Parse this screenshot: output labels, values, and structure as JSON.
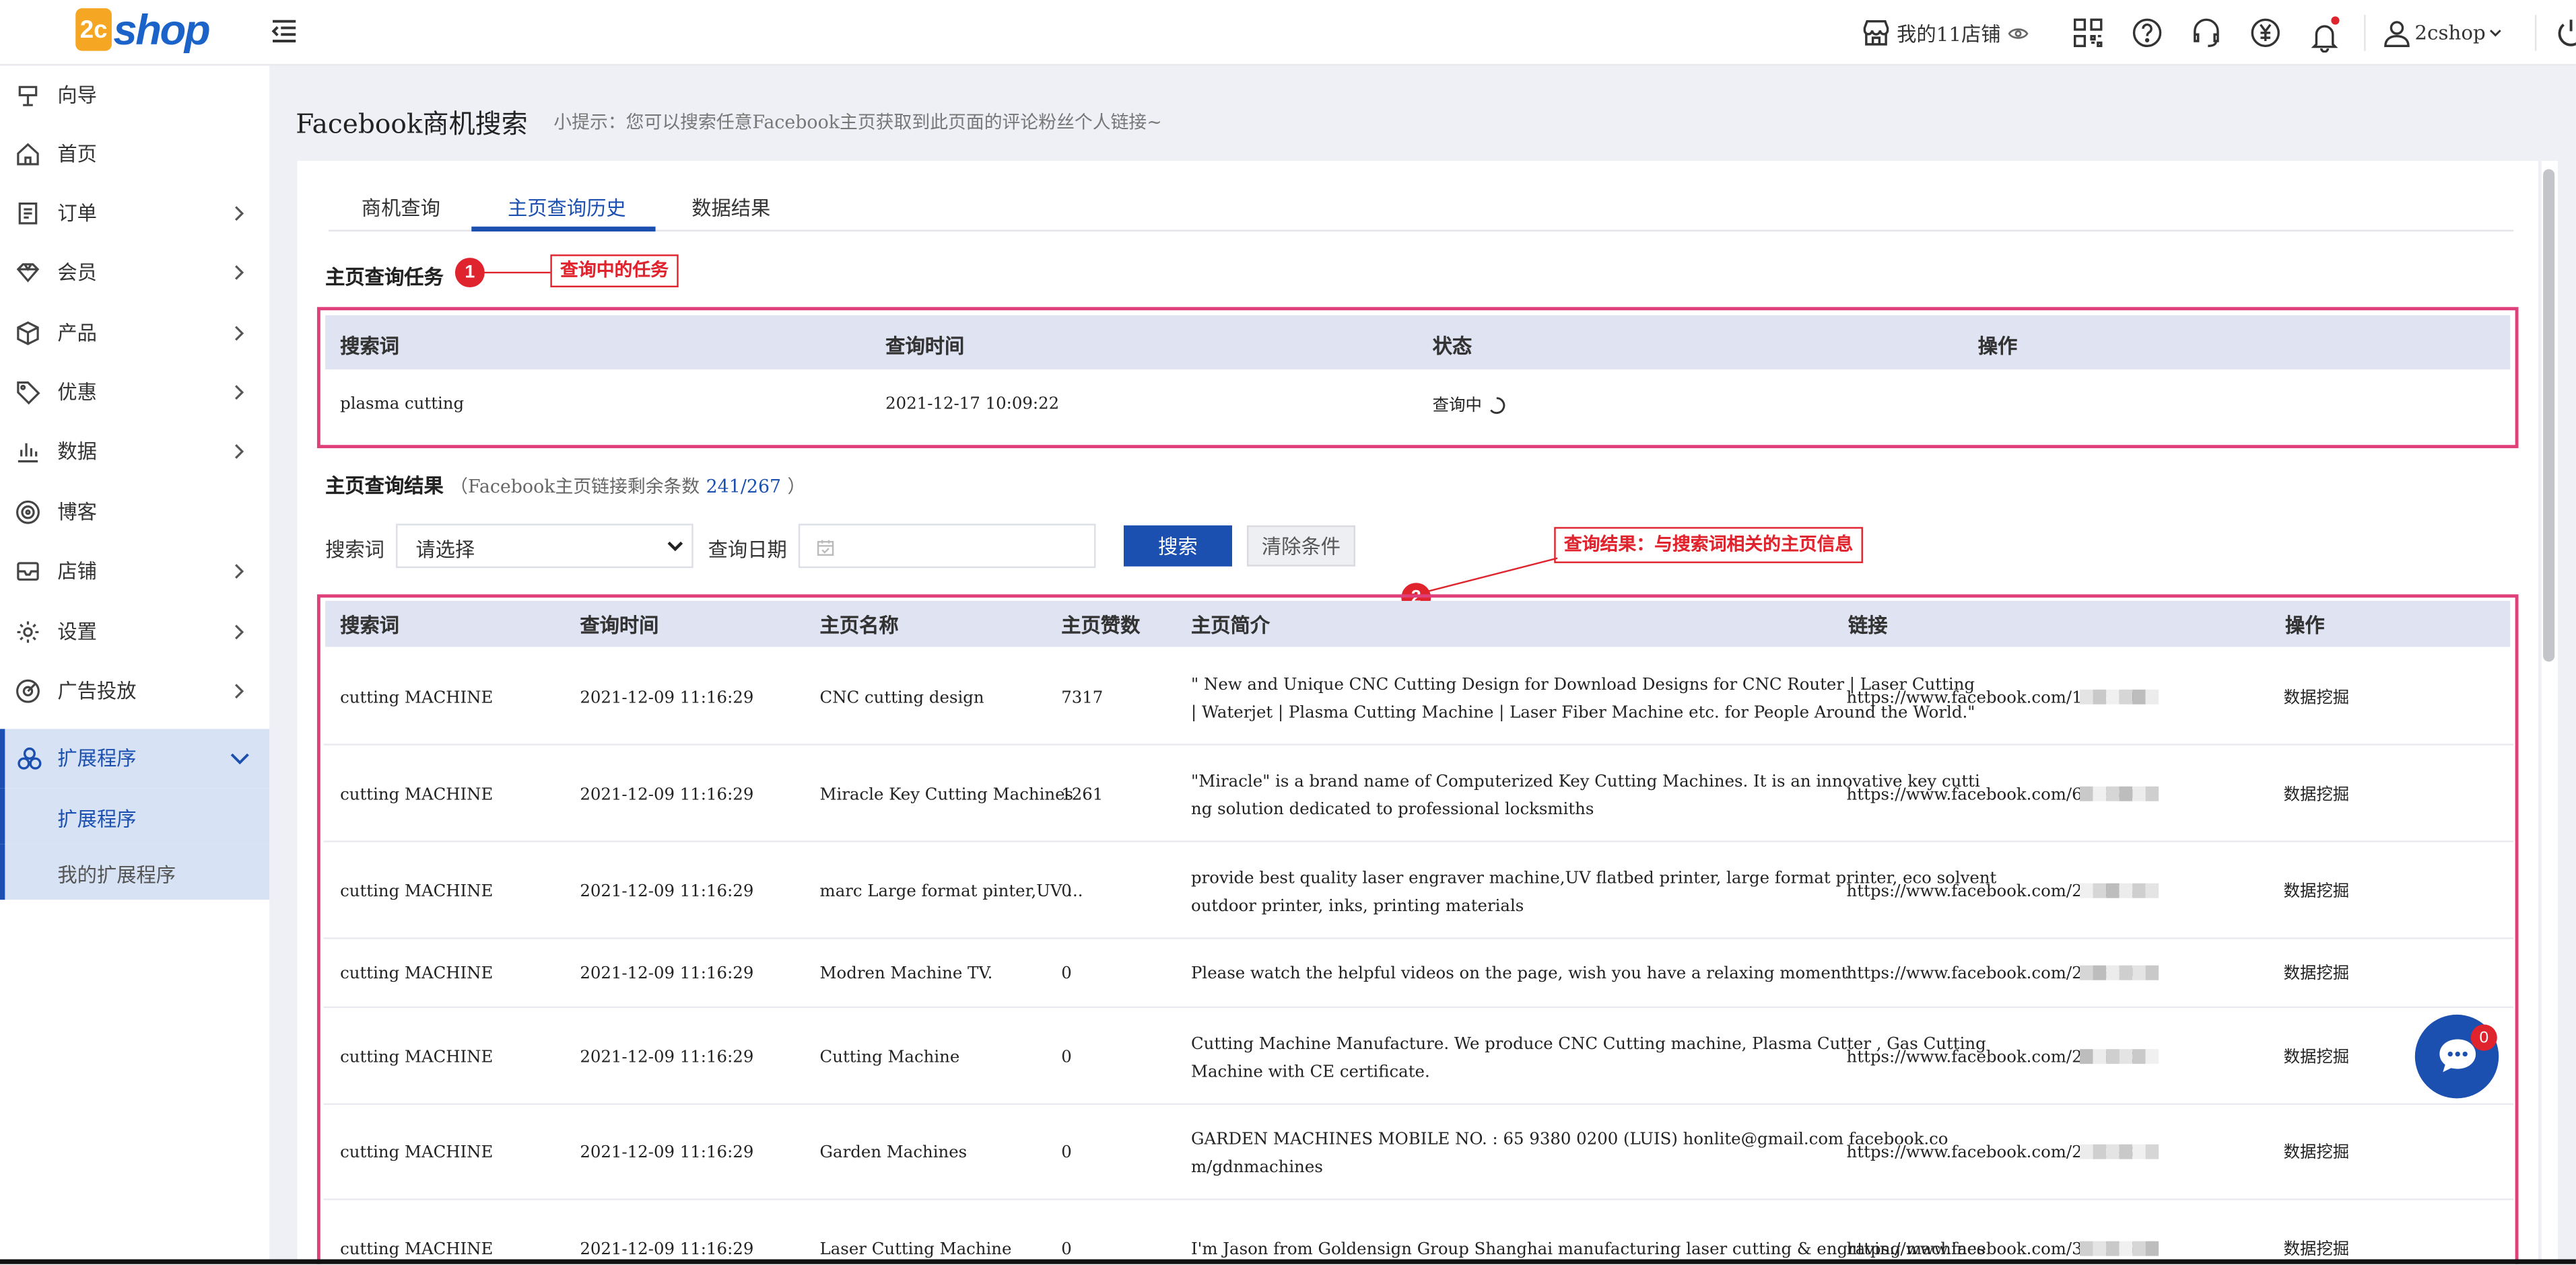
{
  "logo": {
    "badge": "2c",
    "text": "shop"
  },
  "header": {
    "store_label": "我的11店铺",
    "user_label": "2cshop",
    "notification_dot_color": "#e0242e"
  },
  "sidebar": {
    "items": [
      {
        "label": "向导",
        "icon": "guide-icon"
      },
      {
        "label": "首页",
        "icon": "home-icon"
      },
      {
        "label": "订单",
        "icon": "order-icon"
      },
      {
        "label": "会员",
        "icon": "member-icon"
      },
      {
        "label": "产品",
        "icon": "product-icon"
      },
      {
        "label": "优惠",
        "icon": "coupon-icon"
      },
      {
        "label": "数据",
        "icon": "chart-icon"
      },
      {
        "label": "博客",
        "icon": "blog-icon"
      },
      {
        "label": "店铺",
        "icon": "shop-icon"
      },
      {
        "label": "设置",
        "icon": "settings-icon"
      },
      {
        "label": "广告投放",
        "icon": "ads-icon"
      },
      {
        "label": "扩展程序",
        "icon": "extension-icon"
      }
    ],
    "sub_items": [
      "扩展程序",
      "我的扩展程序"
    ]
  },
  "page": {
    "title": "Facebook商机搜索",
    "hint": "小提示：您可以搜索任意Facebook主页获取到此页面的评论粉丝个人链接~"
  },
  "tabs": [
    "商机查询",
    "主页查询历史",
    "数据结果"
  ],
  "task_section": {
    "title": "主页查询任务",
    "marker": "1",
    "callout": "查询中的任务",
    "headers": [
      "搜索词",
      "查询时间",
      "状态",
      "操作"
    ],
    "row": {
      "keyword": "plasma cutting",
      "time": "2021-12-17 10:09:22",
      "status": "查询中"
    }
  },
  "results_section": {
    "title": "主页查询结果",
    "note_prefix": "（Facebook主页链接剩余条数",
    "note_count": "241/267",
    "note_suffix": "）",
    "marker": "2",
    "callout": "查询结果：与搜索词相关的主页信息"
  },
  "filter": {
    "keyword_label": "搜索词",
    "keyword_value": "请选择",
    "date_label": "查询日期",
    "search_button": "搜索",
    "clear_button": "清除条件"
  },
  "results_headers": [
    "搜索词",
    "查询时间",
    "主页名称",
    "主页赞数",
    "主页简介",
    "链接",
    "操作"
  ],
  "results_rows": [
    {
      "keyword": "cutting MACHINE",
      "time": "2021-12-09 11:16:29",
      "name": "CNC cutting design",
      "likes": "7317",
      "intro1": "\" New and Unique CNC Cutting Design for Download Designs for CNC Router | Laser Cutting",
      "intro2": "| Waterjet | Plasma Cutting Machine | Laser Fiber Machine etc. for People Around the World.\"",
      "link": "https://www.facebook.com/171540",
      "action": "数据挖掘"
    },
    {
      "keyword": "cutting MACHINE",
      "time": "2021-12-09 11:16:29",
      "name": "Miracle Key Cutting Machines",
      "likes": "1261",
      "intro1": "\"Miracle\" is a brand name of Computerized Key Cutting Machines. It is an innovative key cutti",
      "intro2": "ng solution dedicated to professional locksmiths",
      "link": "https://www.facebook.com/609970",
      "action": "数据挖掘"
    },
    {
      "keyword": "cutting MACHINE",
      "time": "2021-12-09 11:16:29",
      "name": "marc Large format pinter,UV ...",
      "likes": "0",
      "intro1": "provide best quality laser engraver machine,UV flatbed printer, large format printer, eco solvent",
      "intro2": "outdoor printer, inks, printing materials",
      "link": "https://www.facebook.com/226894",
      "action": "数据挖掘"
    },
    {
      "keyword": "cutting MACHINE",
      "time": "2021-12-09 11:16:29",
      "name": "Modren Machine TV.",
      "likes": "0",
      "intro1": "Please watch the helpful videos on the page, wish you have a relaxing moment",
      "intro2": "",
      "link": "https://www.facebook.com/251669",
      "action": "数据挖掘"
    },
    {
      "keyword": "cutting MACHINE",
      "time": "2021-12-09 11:16:29",
      "name": "Cutting Machine",
      "likes": "0",
      "intro1": "Cutting Machine Manufacture. We produce CNC Cutting machine, Plasma Cutter , Gas Cutting",
      "intro2": "Machine with CE certificate.",
      "link": "https://www.facebook.com/266642",
      "action": "数据挖掘"
    },
    {
      "keyword": "cutting MACHINE",
      "time": "2021-12-09 11:16:29",
      "name": "Garden Machines",
      "likes": "0",
      "intro1": "GARDEN MACHINES MOBILE NO. : 65 9380 0200 (LUIS) honlite@gmail.com facebook.co",
      "intro2": "m/gdnmachines",
      "link": "https://www.facebook.com/279123",
      "action": "数据挖掘"
    },
    {
      "keyword": "cutting MACHINE",
      "time": "2021-12-09 11:16:29",
      "name": "Laser Cutting Machine",
      "likes": "0",
      "intro1": "I'm Jason from Goldensign Group Shanghai manufacturing laser cutting & engraving machines",
      "intro2": "",
      "link": "https://www.facebook.com/328306",
      "action": "数据挖掘"
    }
  ],
  "chat": {
    "badge": "0"
  },
  "colors": {
    "accent": "#1b4fb0",
    "highlight": "#e0242e",
    "annotation_border": "#e0407a"
  }
}
